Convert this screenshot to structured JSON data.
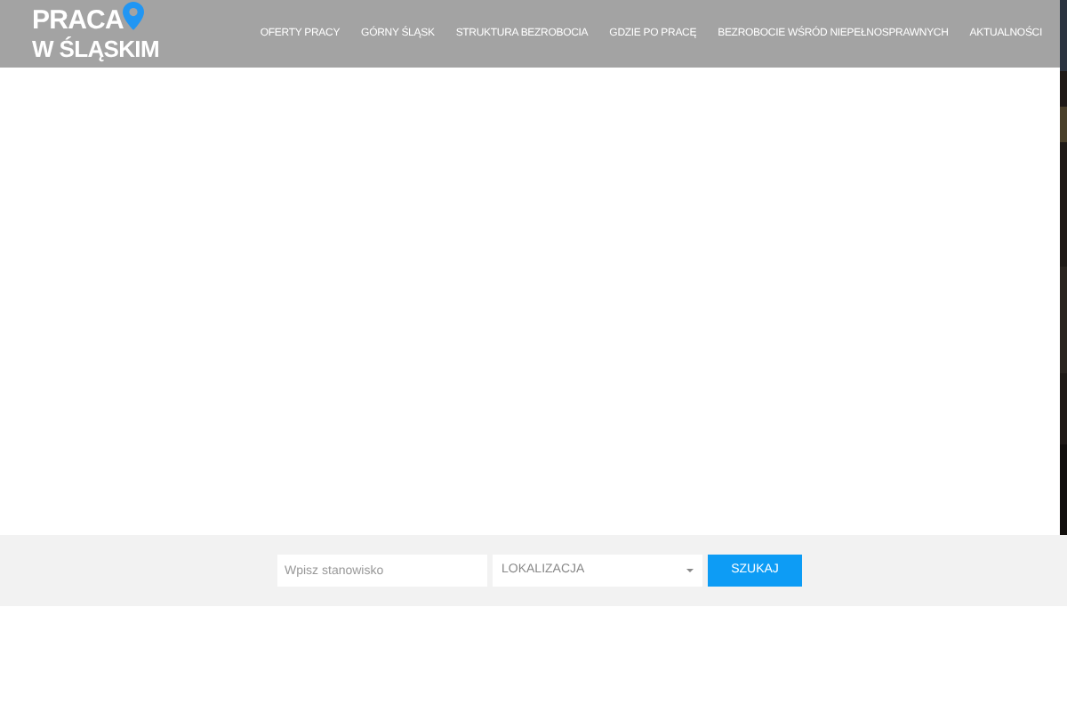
{
  "logo": {
    "line_1": "PRACA",
    "line_2": "W ŚLĄSKIM"
  },
  "nav": [
    {
      "label": "OFERTY PRACY"
    },
    {
      "label": "GÓRNY ŚLĄSK"
    },
    {
      "label": "STRUKTURA BEZROBOCIA"
    },
    {
      "label": "GDZIE PO PRACĘ"
    },
    {
      "label": "BEZROBOCIE WŚRÓD NIEPEŁNOSPRAWNYCH"
    },
    {
      "label": "AKTUALNOŚCI"
    }
  ],
  "search": {
    "position_placeholder": "Wpisz stanowisko",
    "location": "LOKALIZACJA",
    "button": "SZUKAJ"
  }
}
